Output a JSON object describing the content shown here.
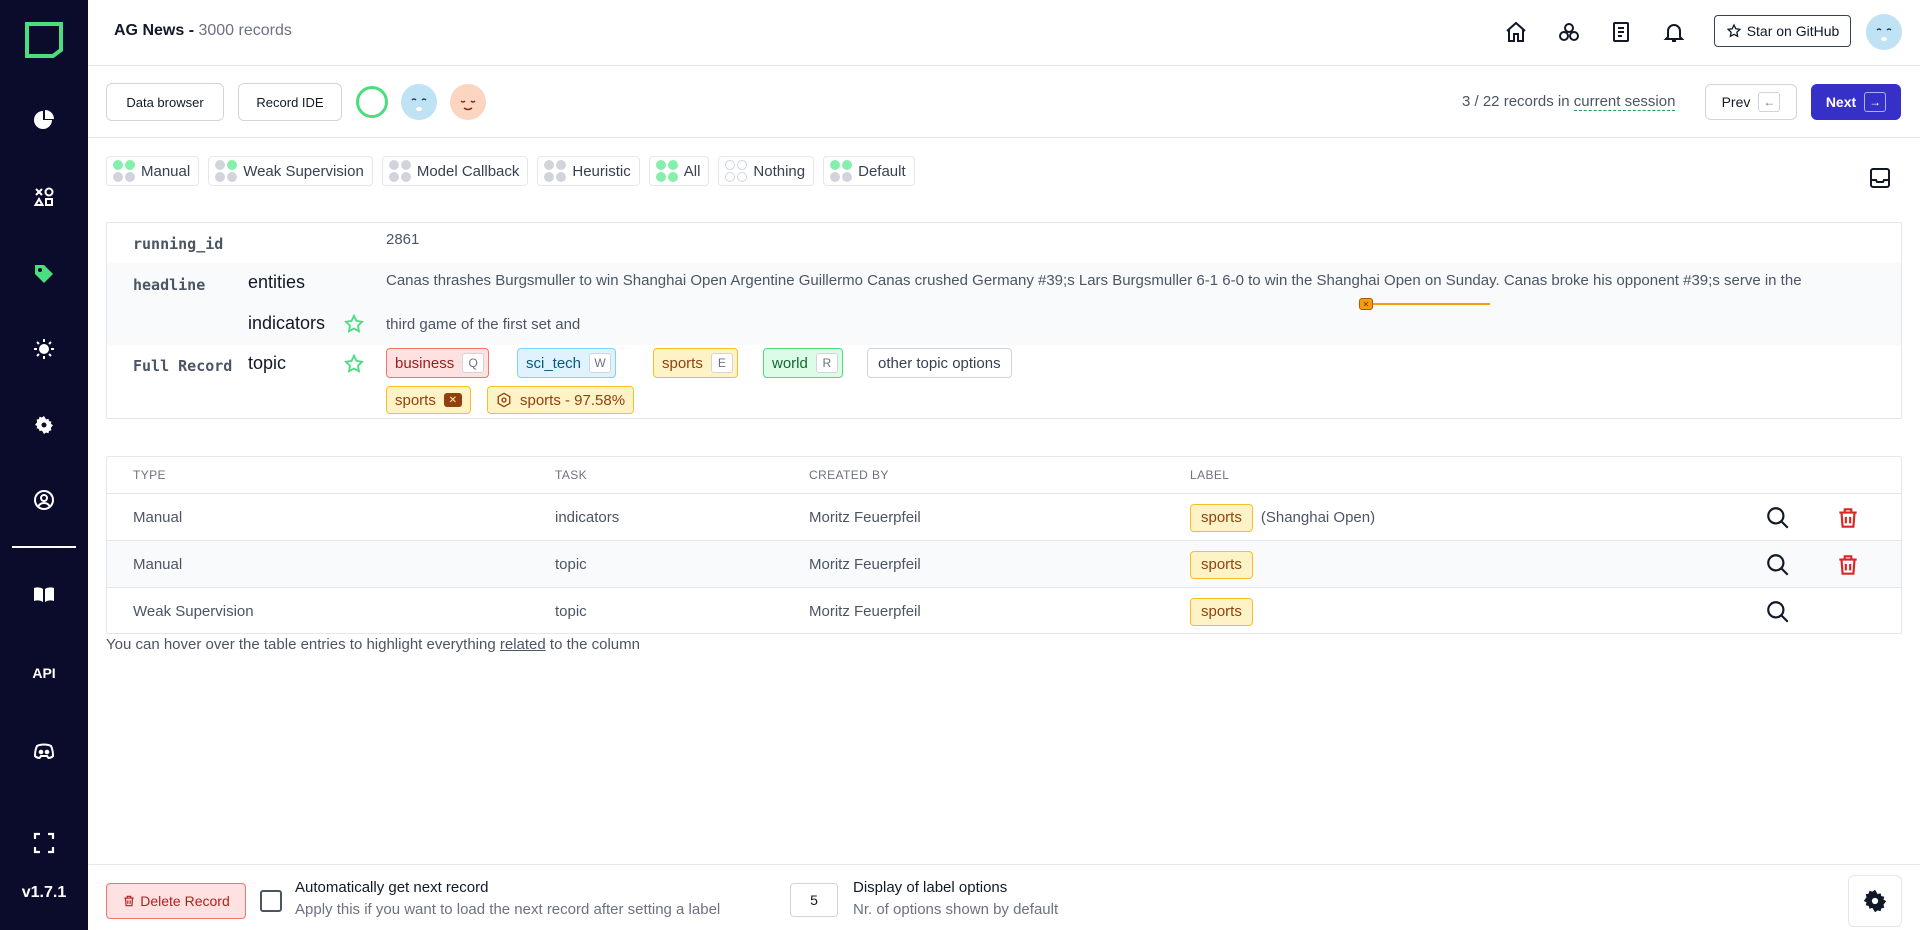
{
  "sidebar": {
    "logo": "kern-logo-icon",
    "items": [
      {
        "name": "overview",
        "icon": "pie-chart-icon"
      },
      {
        "name": "data-browser",
        "icon": "shapes-icon"
      },
      {
        "name": "labeling",
        "icon": "tag-icon",
        "active": true
      },
      {
        "name": "heuristics",
        "icon": "bulb-icon"
      },
      {
        "name": "settings",
        "icon": "gear-icon"
      },
      {
        "name": "users",
        "icon": "user-circle-icon"
      },
      {
        "name": "docs",
        "icon": "book-icon"
      },
      {
        "name": "api",
        "label": "API"
      },
      {
        "name": "community",
        "icon": "discord-icon"
      },
      {
        "name": "fullscreen",
        "icon": "fullscreen-icon"
      }
    ],
    "version": "v1.7.1"
  },
  "header": {
    "project_name": "AG News - ",
    "record_count": "3000 records",
    "github_label": "Star on GitHub"
  },
  "toolbar": {
    "data_browser_label": "Data browser",
    "record_ide_label": "Record IDE",
    "session_prefix": "3 / 22 records in ",
    "session_link": "current session",
    "prev_label": "Prev",
    "next_label": "Next"
  },
  "filters": [
    {
      "label": "Manual",
      "dots": [
        "g",
        "g",
        "x",
        "x"
      ]
    },
    {
      "label": "Weak Supervision",
      "dots": [
        "x",
        "g",
        "x",
        "x"
      ]
    },
    {
      "label": "Model Callback",
      "dots": [
        "x",
        "x",
        "x",
        "x"
      ]
    },
    {
      "label": "Heuristic",
      "dots": [
        "x",
        "x",
        "x",
        "x"
      ]
    },
    {
      "label": "All",
      "dots": [
        "g",
        "g",
        "g",
        "g"
      ]
    },
    {
      "label": "Nothing",
      "dots": [
        "o",
        "o",
        "o",
        "o"
      ]
    },
    {
      "label": "Default",
      "dots": [
        "g",
        "g",
        "x",
        "x"
      ]
    }
  ],
  "record": {
    "running_id_key": "running_id",
    "running_id_value": "2861",
    "headline_key": "headline",
    "headline_sub_1": "entities",
    "headline_sub_2": "indicators",
    "headline_text_1": "Canas thrashes Burgsmuller to win Shanghai Open Argentine Guillermo Canas crushed Germany #39;s Lars Burgsmuller 6-1 6-0 to win the Shanghai Open on Sunday. Canas broke his opponent #39;s serve in the",
    "headline_text_2": "third game of the first set and",
    "full_record_key": "Full Record",
    "topic_sub": "topic",
    "topic_options": [
      {
        "label": "business",
        "key": "Q",
        "style": "business"
      },
      {
        "label": "sci_tech",
        "key": "W",
        "style": "sci"
      },
      {
        "label": "sports",
        "key": "E",
        "style": "sports"
      },
      {
        "label": "world",
        "key": "R",
        "style": "world"
      }
    ],
    "other_options_label": "other topic options",
    "assigned_label": "sports",
    "prediction_label": "sports - 97.58%"
  },
  "table": {
    "headers": {
      "type": "TYPE",
      "task": "TASK",
      "created_by": "CREATED BY",
      "label": "LABEL"
    },
    "rows": [
      {
        "type": "Manual",
        "task": "indicators",
        "created_by": "Moritz Feuerpfeil",
        "label": "sports",
        "extra": "(Shanghai Open)",
        "delete": true
      },
      {
        "type": "Manual",
        "task": "topic",
        "created_by": "Moritz Feuerpfeil",
        "label": "sports",
        "extra": "",
        "delete": true
      },
      {
        "type": "Weak Supervision",
        "task": "topic",
        "created_by": "Moritz Feuerpfeil",
        "label": "sports",
        "extra": "",
        "delete": false
      }
    ],
    "hint_prefix": "You can hover over the table entries to highlight everything ",
    "hint_link": "related",
    "hint_suffix": " to the column"
  },
  "footer": {
    "delete_label": "Delete Record",
    "auto_next_title": "Automatically get next record",
    "auto_next_sub": "Apply this if you want to load the next record after setting a label",
    "options_count": "5",
    "display_title": "Display of label options",
    "display_sub": "Nr. of options shown by default"
  }
}
